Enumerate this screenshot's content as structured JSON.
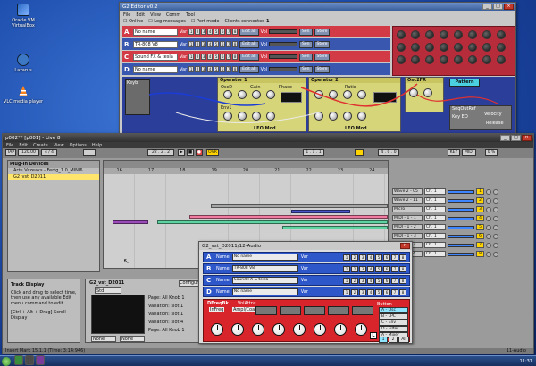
{
  "desktop": {
    "icons": [
      {
        "label": "Oracle VM VirtualBox",
        "icon": "virtualbox-icon"
      },
      {
        "label": "Lazarus",
        "icon": "lazarus-icon"
      },
      {
        "label": "VLC media player",
        "icon": "vlc-cone-icon"
      }
    ]
  },
  "editor": {
    "title": "G2 Editor v0.2",
    "menu": [
      "File",
      "Edit",
      "View",
      "Comm",
      "Tool"
    ],
    "options": [
      "Online",
      "Log messages",
      "Perf mode",
      "Clients connected"
    ],
    "clients_count": "1",
    "slots": [
      {
        "letter": "A",
        "name": "No name",
        "label_var": "Var",
        "label_edit": "Edit all",
        "label_vol": "Vol",
        "sel": "Sen",
        "btn": "Store"
      },
      {
        "letter": "B",
        "name": "TR-808 V8",
        "label_var": "Var",
        "label_edit": "Edit all",
        "label_vol": "Vol",
        "sel": "Sen",
        "btn": "Store"
      },
      {
        "letter": "C",
        "name": "Sound FX & tesla",
        "label_var": "Var",
        "label_edit": "Edit all",
        "label_vol": "Vol",
        "sel": "Sen",
        "btn": "Store"
      },
      {
        "letter": "D",
        "name": "No name",
        "label_var": "Var",
        "label_edit": "Edit all",
        "label_vol": "Vol",
        "sel": "Sen",
        "btn": "Store"
      }
    ],
    "var_numbers": [
      "1",
      "2",
      "3",
      "4",
      "5",
      "6",
      "7",
      "8"
    ],
    "modules": {
      "op1": "Operator 1",
      "op2": "Operator 2",
      "osc_d": "OscD",
      "osc2fr": "Osc2FR",
      "lfo1": "LFO Mod",
      "lfo2": "LFO Mod",
      "env": "Env1",
      "pattern": "Pattern",
      "keyb": "Keyb",
      "seqout": "SeqOutRef",
      "velocity": "Velocity",
      "key_eo": "Key EO",
      "release": "Release",
      "gain": "Gain",
      "ratio": "Ratio",
      "phase": "Phase"
    }
  },
  "live": {
    "title": "p002** [p001] - Live 8",
    "menu": [
      "File",
      "Edit",
      "Create",
      "View",
      "Options",
      "Help"
    ],
    "transport": {
      "tap": "TAP",
      "bpm": "120.00",
      "sig": "4 / 4",
      "bars": "22 . 2 . 2",
      "loop": "OVR",
      "pos": "1 . 1 . 1",
      "end": "4 . 0 . 0",
      "key": "KEY",
      "midi": "MIDI",
      "cpu": "0 %"
    },
    "browser": {
      "header": "Plug-In Devices",
      "items": [
        "Artu Vazeaks - Fertg_1.0_MINI6",
        "G2_vst_D2011"
      ],
      "selected": 1
    },
    "timeline": [
      "16",
      "17",
      "18",
      "19",
      "20",
      "21",
      "22",
      "23",
      "24"
    ],
    "tracks": [
      {
        "name": "Wave 2 - 05",
        "ch": "Ch. 1",
        "num": "1"
      },
      {
        "name": "Wave 2 - 11",
        "ch": "Ch. 1",
        "num": "2"
      },
      {
        "name": "Micro",
        "ch": "Ch. 1",
        "num": "3"
      },
      {
        "name": "MIDI - 1 - 1",
        "ch": "Ch. 1",
        "num": "4"
      },
      {
        "name": "MIDI - 1 - 2",
        "ch": "Ch. 1",
        "num": "5"
      },
      {
        "name": "MIDI - 1 - 3",
        "ch": "Ch. 1",
        "num": "6"
      },
      {
        "name": "MIDI - 1 - 4",
        "ch": "Ch. 1",
        "num": "7"
      },
      {
        "name": "Wave 2 - 4",
        "ch": "Ch. 1",
        "num": "8"
      }
    ],
    "track_display": {
      "title": "Track Display",
      "text1": "Click and drag to select time, then use any available Edit menu command to edit.",
      "text2": "[Ctrl + Alt + Drag] Scroll Display"
    },
    "device": {
      "name": "G2_vst_D2011",
      "preset": "Std",
      "configure": "Configure",
      "params": [
        "Page: All Knob 1",
        "Variation: slot 1",
        "Variation: slot 1",
        "Variation: slot 4",
        "Page: All Knob 1"
      ],
      "bottom": [
        "None",
        "None"
      ]
    },
    "status": {
      "left": "Insert Mark 15.1.1 (Time: 3:14:946)",
      "right": "11-Audio"
    }
  },
  "plugin": {
    "title": "G2_vst_D2011/12-Audio",
    "slots": [
      {
        "letter": "A",
        "label": "Name",
        "name": "No name",
        "var": "Var"
      },
      {
        "letter": "B",
        "label": "Name",
        "name": "TR-808 V8",
        "var": "Var"
      },
      {
        "letter": "C",
        "label": "Name",
        "name": "Sound FX & tesla",
        "var": "Var"
      },
      {
        "letter": "D",
        "label": "Name",
        "name": "No name",
        "var": "Var"
      }
    ],
    "numbers": [
      "1",
      "2",
      "3",
      "4",
      "5",
      "6",
      "7",
      "8"
    ],
    "filter": {
      "title": "DFreqBk",
      "subtitle": "VolAttns",
      "labels": [
        "InFreq",
        "Ampl/Coarse"
      ]
    },
    "clock": {
      "label": "Button",
      "types": [
        "A - Osc",
        "B - LPC",
        "C - Env",
        "D - Filter",
        "A - Mixer",
        "All"
      ]
    },
    "l_badge": "L",
    "page": [
      "1",
      "2"
    ]
  },
  "taskbar": {
    "clock": "11:31"
  }
}
